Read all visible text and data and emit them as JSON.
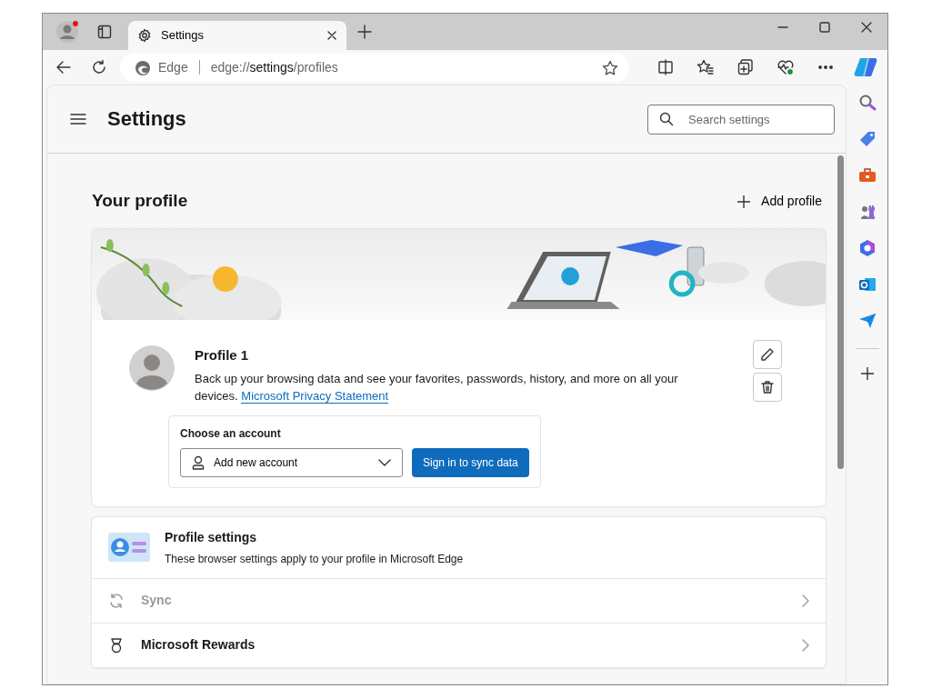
{
  "tabs": [
    {
      "label": "Settings",
      "selected": true
    }
  ],
  "address_bar": {
    "site_label": "Edge",
    "url_scheme": "edge://",
    "url_host": "settings",
    "url_path": "/profiles"
  },
  "settings": {
    "title": "Settings",
    "search": {
      "placeholder": "Search settings"
    }
  },
  "your_profile": {
    "heading": "Your profile",
    "add_button": "Add profile",
    "profile": {
      "name": "Profile 1",
      "description": "Back up your browsing data and see your favorites, passwords, history, and more on all your devices.",
      "link": "Microsoft Privacy Statement"
    },
    "account": {
      "label": "Choose an account",
      "selection": "Add new account",
      "sign_in_button": "Sign in to sync data"
    }
  },
  "profile_settings": {
    "title": "Profile settings",
    "subtitle": "These browser settings apply to your profile in Microsoft Edge",
    "rows": [
      {
        "label": "Sync",
        "kind": "sync",
        "disabled": true
      },
      {
        "label": "Microsoft Rewards",
        "kind": "rewards",
        "disabled": false
      }
    ]
  }
}
